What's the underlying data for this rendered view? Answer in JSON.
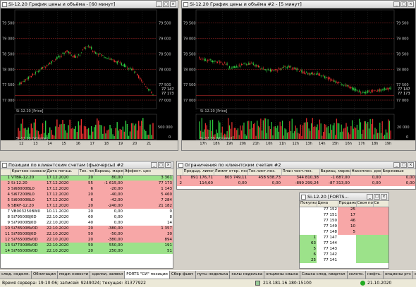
{
  "chart1": {
    "title": "Si-12.20 График цены и объёма - [60 минут]",
    "price_ticks": [
      "79 500",
      "79 000",
      "78 500",
      "78 000",
      "77 500",
      "77 000"
    ],
    "last1": "77 147",
    "last2": "77 173",
    "price_label": "Si-12.20 [Price]",
    "vol_label": "Si-12.20 [Volume]",
    "vol_tick": "500 000",
    "vol_zero": "0",
    "dates": [
      "12",
      "13",
      "14",
      "15",
      "16",
      "17",
      "18",
      "19",
      "20",
      "21"
    ]
  },
  "chart2": {
    "title": "Si-12.20 График цены и объёма #2 - [5 минут]",
    "price_ticks": [
      "79 500",
      "79 000",
      "78 500",
      "78 000",
      "77 500",
      "77 000"
    ],
    "last1": "77 147",
    "last2": "77 173",
    "price_label": "Si-12.20 [Price]",
    "vol_label": "Si-12.20 [Volume]",
    "vol_tick": "20 000",
    "vol_zero": "0",
    "times": [
      "17h",
      "18h",
      "19h",
      "20h",
      "21h",
      "10h",
      "11h",
      "12h",
      "13h",
      "14h",
      "15h",
      "16h",
      "17h",
      "18h",
      "19h"
    ],
    "date": "21"
  },
  "positions": {
    "title": "Позиции по клиентским счетам (фьючерсы) #2",
    "headers": [
      "Краткое название",
      "Дата погаш.",
      "Тек. чист.",
      "Вариац. маржа",
      "Эффект. цен"
    ],
    "rows": [
      {
        "n": "1",
        "name": "VTBR-12.20",
        "date": "17.12.2020",
        "net": "20",
        "var": "80,00",
        "eff": "3 361",
        "c": "g"
      },
      {
        "n": "2",
        "name": "Si-12.20",
        "date": "17.12.2020",
        "net": "55",
        "var": "-1 615,00",
        "eff": "77 173",
        "c": "r"
      },
      {
        "n": "3",
        "name": "Si68000BL0",
        "date": "17.12.2020",
        "net": "6",
        "var": "-20,00",
        "eff": "1 143",
        "c": "r"
      },
      {
        "n": "4",
        "name": "Si67200BL0",
        "date": "17.12.2020",
        "net": "20",
        "var": "-40,00",
        "eff": "5 460",
        "c": "r"
      },
      {
        "n": "5",
        "name": "Si60000BL0",
        "date": "17.12.2020",
        "net": "6",
        "var": "-42,00",
        "eff": "7 284",
        "c": "r"
      },
      {
        "n": "6",
        "name": "SBRF-12.20",
        "date": "17.12.2020",
        "net": "20",
        "var": "-240,00",
        "eff": "21 182",
        "c": "r"
      },
      {
        "n": "7",
        "name": "VB003250BW0",
        "date": "10.11.2020",
        "net": "20",
        "var": "0,00",
        "eff": "0",
        "c": "w"
      },
      {
        "n": "8",
        "name": "Si79500BJ0D",
        "date": "22.10.2020",
        "net": "60",
        "var": "0,00",
        "eff": "8",
        "c": "w"
      },
      {
        "n": "9",
        "name": "Si79000BJ0D",
        "date": "22.10.2020",
        "net": "40",
        "var": "0,00",
        "eff": "14",
        "c": "w"
      },
      {
        "n": "10",
        "name": "Si78500BV0D",
        "date": "22.10.2020",
        "net": "20",
        "var": "-380,00",
        "eff": "1 357",
        "c": "r"
      },
      {
        "n": "11",
        "name": "Si78500BJ0D",
        "date": "22.10.2020",
        "net": "50",
        "var": "-50,00",
        "eff": "30",
        "c": "r"
      },
      {
        "n": "12",
        "name": "Si76500BV0D",
        "date": "22.10.2020",
        "net": "20",
        "var": "-380,00",
        "eff": "894",
        "c": "r"
      },
      {
        "n": "13",
        "name": "Si77000BV0D",
        "date": "22.10.2020",
        "net": "50",
        "var": "550,00",
        "eff": "191",
        "c": "g"
      },
      {
        "n": "14",
        "name": "Si76500BV0D",
        "date": "22.10.2020",
        "net": "20",
        "var": "250,00",
        "eff": "51",
        "c": "g"
      }
    ]
  },
  "limits": {
    "title": "Ограничения по клиентским счетам #2",
    "headers": [
      "Предыд. лимит",
      "Лимит откр. поз.",
      "Тек.чист.поз.",
      "План чист.поз.",
      "Вариац. маржа",
      "Накоплен. доход",
      "Биржевые"
    ],
    "rows": [
      {
        "n": "1",
        "cells": [
          "891 176,71",
          "803 749,11",
          "458 938,73",
          "344 810,38",
          "-1 687,00",
          "0,00",
          "0,00"
        ],
        "c": "r"
      },
      {
        "n": "2",
        "cells": [
          "114,60",
          "0,00",
          "0,00",
          "-899 299,24",
          "-87 313,00",
          "0,00",
          "0,00"
        ],
        "c": "r"
      }
    ]
  },
  "orderbook": {
    "title": "Si-12.20 [FORTS...",
    "headers": [
      "Покупка",
      "Цена",
      "Продажа",
      "Своя по",
      "Св"
    ],
    "rows": [
      {
        "buy": "",
        "price": "77 152",
        "sell": "25"
      },
      {
        "buy": "",
        "price": "77 151",
        "sell": "17"
      },
      {
        "buy": "",
        "price": "77 150",
        "sell": "46"
      },
      {
        "buy": "",
        "price": "77 149",
        "sell": "10"
      },
      {
        "buy": "",
        "price": "77 148",
        "sell": "5"
      },
      {
        "buy": "1",
        "price": "77 147",
        "sell": ""
      },
      {
        "buy": "63",
        "price": "77 144",
        "sell": ""
      },
      {
        "buy": "5",
        "price": "77 143",
        "sell": ""
      },
      {
        "buy": "6",
        "price": "77 142",
        "sell": ""
      },
      {
        "buy": "25",
        "price": "77 141",
        "sell": ""
      }
    ]
  },
  "tabs": [
    "след. неделя.",
    "Облигации",
    "медж новости",
    "сделки, заявки",
    "FORTS \"СИ\" позиции",
    "Сбер фьюч",
    "путы неделька",
    "колы неделька",
    "опционы сишка",
    "Сишка след. квартал",
    "золото.",
    "нефть.",
    "опционы ртс",
    "втб"
  ],
  "active_tab": 4,
  "status": {
    "text": "Время сервера: 19:10:06; записей: 9249024; текущая: 31377922",
    "ip": "213.181.16.180:15100",
    "date": "21.10.2020"
  }
}
